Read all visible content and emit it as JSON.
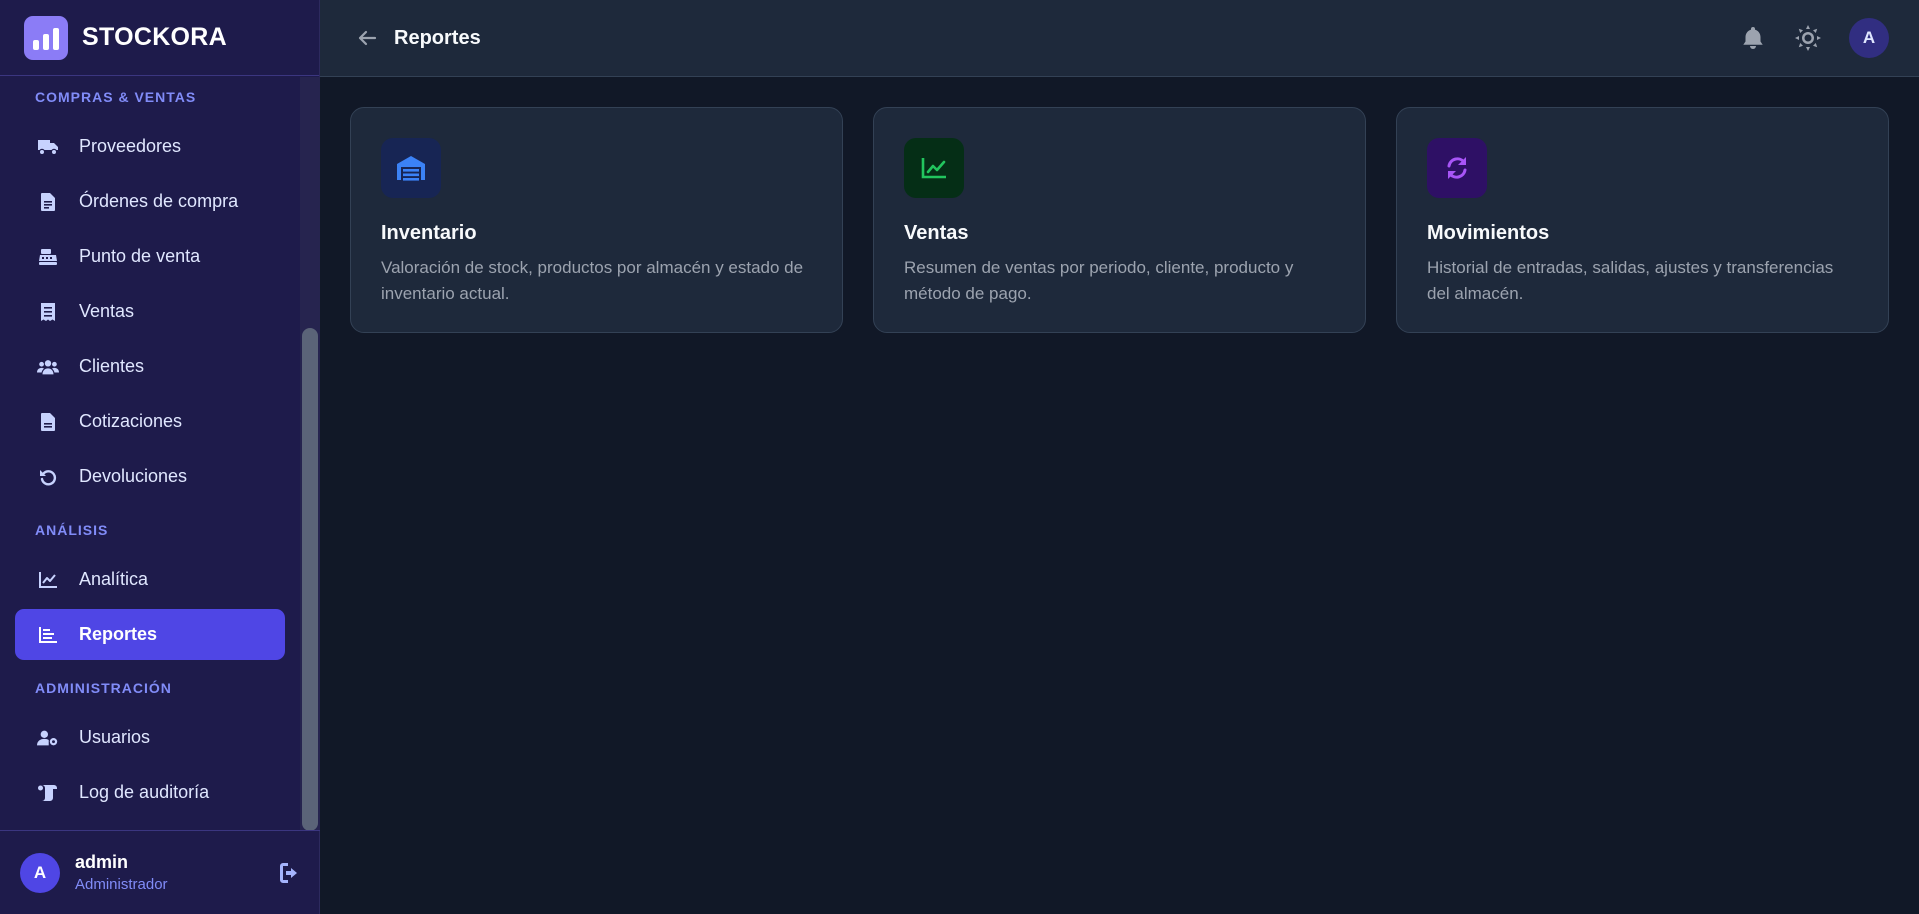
{
  "brand": {
    "name": "STOCKORA"
  },
  "sidebar": {
    "sections": [
      {
        "title": "COMPRAS & VENTAS",
        "items": [
          {
            "label": "Proveedores",
            "icon": "truck-icon"
          },
          {
            "label": "Órdenes de compra",
            "icon": "file-invoice-icon"
          },
          {
            "label": "Punto de venta",
            "icon": "cash-register-icon"
          },
          {
            "label": "Ventas",
            "icon": "receipt-icon"
          },
          {
            "label": "Clientes",
            "icon": "users-icon"
          },
          {
            "label": "Cotizaciones",
            "icon": "file-icon"
          },
          {
            "label": "Devoluciones",
            "icon": "undo-icon"
          }
        ]
      },
      {
        "title": "ANÁLISIS",
        "items": [
          {
            "label": "Analítica",
            "icon": "chart-line-icon"
          },
          {
            "label": "Reportes",
            "icon": "chart-bar-icon",
            "active": true
          }
        ]
      },
      {
        "title": "ADMINISTRACIÓN",
        "items": [
          {
            "label": "Usuarios",
            "icon": "user-gear-icon"
          },
          {
            "label": "Log de auditoría",
            "icon": "scroll-icon"
          }
        ]
      }
    ]
  },
  "user": {
    "initial": "A",
    "name": "admin",
    "role": "Administrador"
  },
  "header": {
    "title": "Reportes",
    "avatar_initial": "A"
  },
  "cards": [
    {
      "title": "Inventario",
      "description": "Valoración de stock, productos por almacén y estado de inventario actual.",
      "icon": "warehouse-icon",
      "icon_bg": "#172554",
      "icon_color": "#3b82f6"
    },
    {
      "title": "Ventas",
      "description": "Resumen de ventas por periodo, cliente, producto y método de pago.",
      "icon": "chart-line-icon",
      "icon_bg": "#052e16",
      "icon_color": "#22c55e"
    },
    {
      "title": "Movimientos",
      "description": "Historial de entradas, salidas, ajustes y transferencias del almacén.",
      "icon": "sync-icon",
      "icon_bg": "#2e1065",
      "icon_color": "#a855f7"
    }
  ],
  "colors": {
    "accent": "#4f46e5",
    "sidebar_bg": "#1e1b4b",
    "main_bg": "#111827",
    "card_bg": "#1e293b"
  }
}
